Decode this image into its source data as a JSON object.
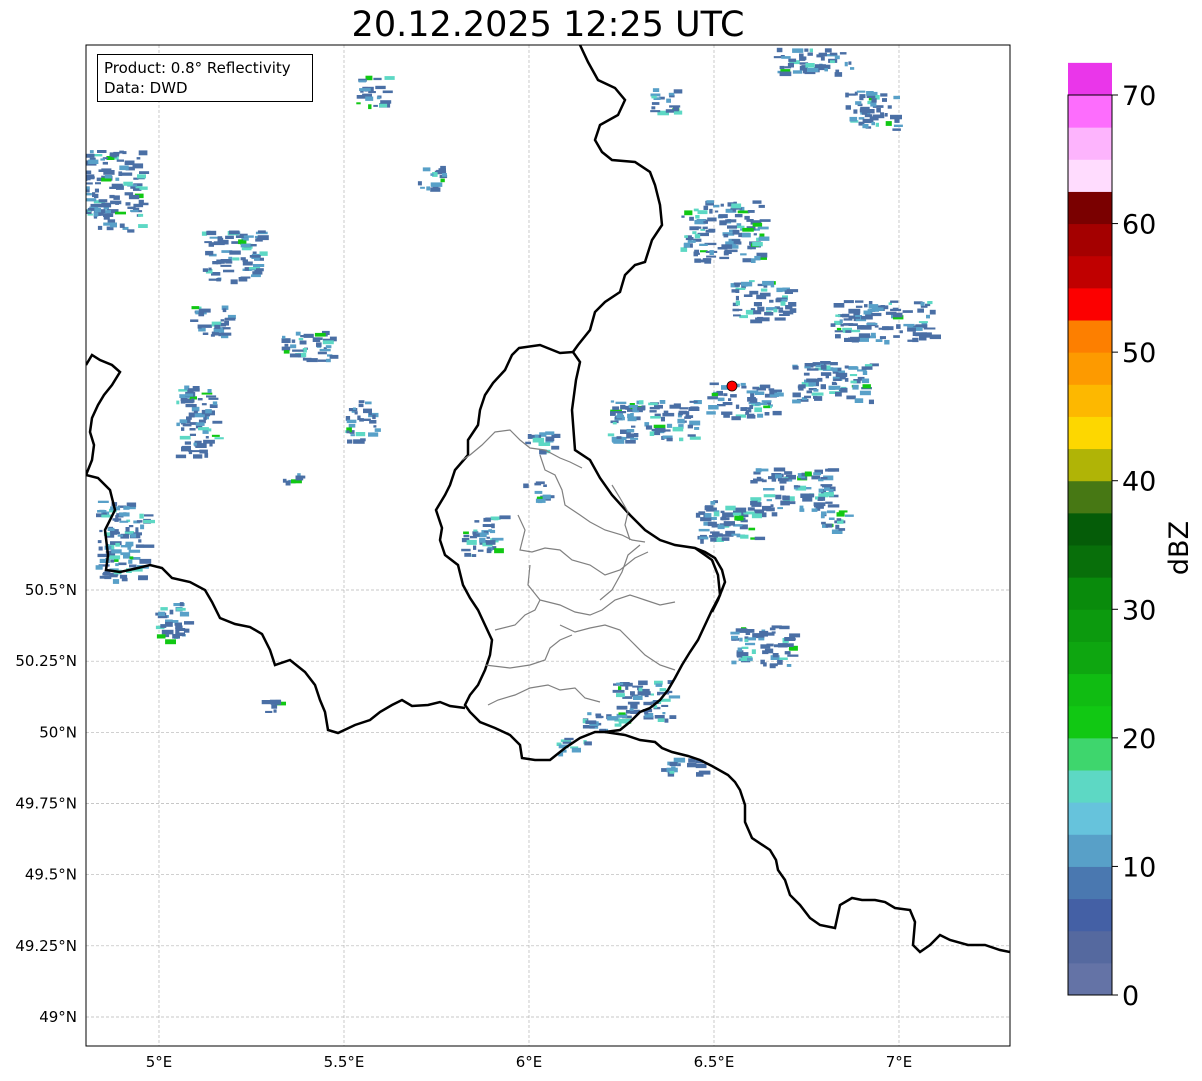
{
  "title": "20.12.2025 12:25 UTC",
  "info_box": {
    "product_line": "Product: 0.8° Reflectivity",
    "data_line": "Data: DWD"
  },
  "axes": {
    "lon_ticks": [
      {
        "value": 5.0,
        "label": "5°E"
      },
      {
        "value": 5.5,
        "label": "5.5°E"
      },
      {
        "value": 6.0,
        "label": "6°E"
      },
      {
        "value": 6.5,
        "label": "6.5°E"
      },
      {
        "value": 7.0,
        "label": "7°E"
      }
    ],
    "lat_ticks": [
      {
        "value": 50.5,
        "label": "50.5°N"
      },
      {
        "value": 50.25,
        "label": "50.25°N"
      },
      {
        "value": 50.0,
        "label": "50°N"
      },
      {
        "value": 49.75,
        "label": "49.75°N"
      },
      {
        "value": 49.5,
        "label": "49.5°N"
      },
      {
        "value": 49.25,
        "label": "49.25°N"
      },
      {
        "value": 49.0,
        "label": "49°N"
      }
    ],
    "grid": true
  },
  "colorbar": {
    "label": "dBZ",
    "tick_labels": [
      "0",
      "10",
      "20",
      "30",
      "40",
      "50",
      "60",
      "70"
    ],
    "colors": [
      "#6473a6",
      "#55699f",
      "#4460a5",
      "#4a78b0",
      "#58a0c8",
      "#66c3dc",
      "#5dd8c4",
      "#3ed66d",
      "#11c813",
      "#10bc12",
      "#0ea610",
      "#0c9a0e",
      "#098b0c",
      "#086f0a",
      "#055c08",
      "#477814",
      "#b0b406",
      "#fdd700",
      "#fdb800",
      "#fd9a00",
      "#fd7f00",
      "#fc0000",
      "#c00000",
      "#a40000",
      "#7a0000",
      "#ffdcfe",
      "#fdb4fd",
      "#fd6dfd",
      "#ea36ea"
    ]
  },
  "radar_site": {
    "name": "radar-site",
    "color": "#ff0000"
  },
  "precip_colors": {
    "light": "#4a6fa5",
    "medium": "#58a0c8",
    "teal": "#5dd8c4",
    "green": "#11c813"
  }
}
